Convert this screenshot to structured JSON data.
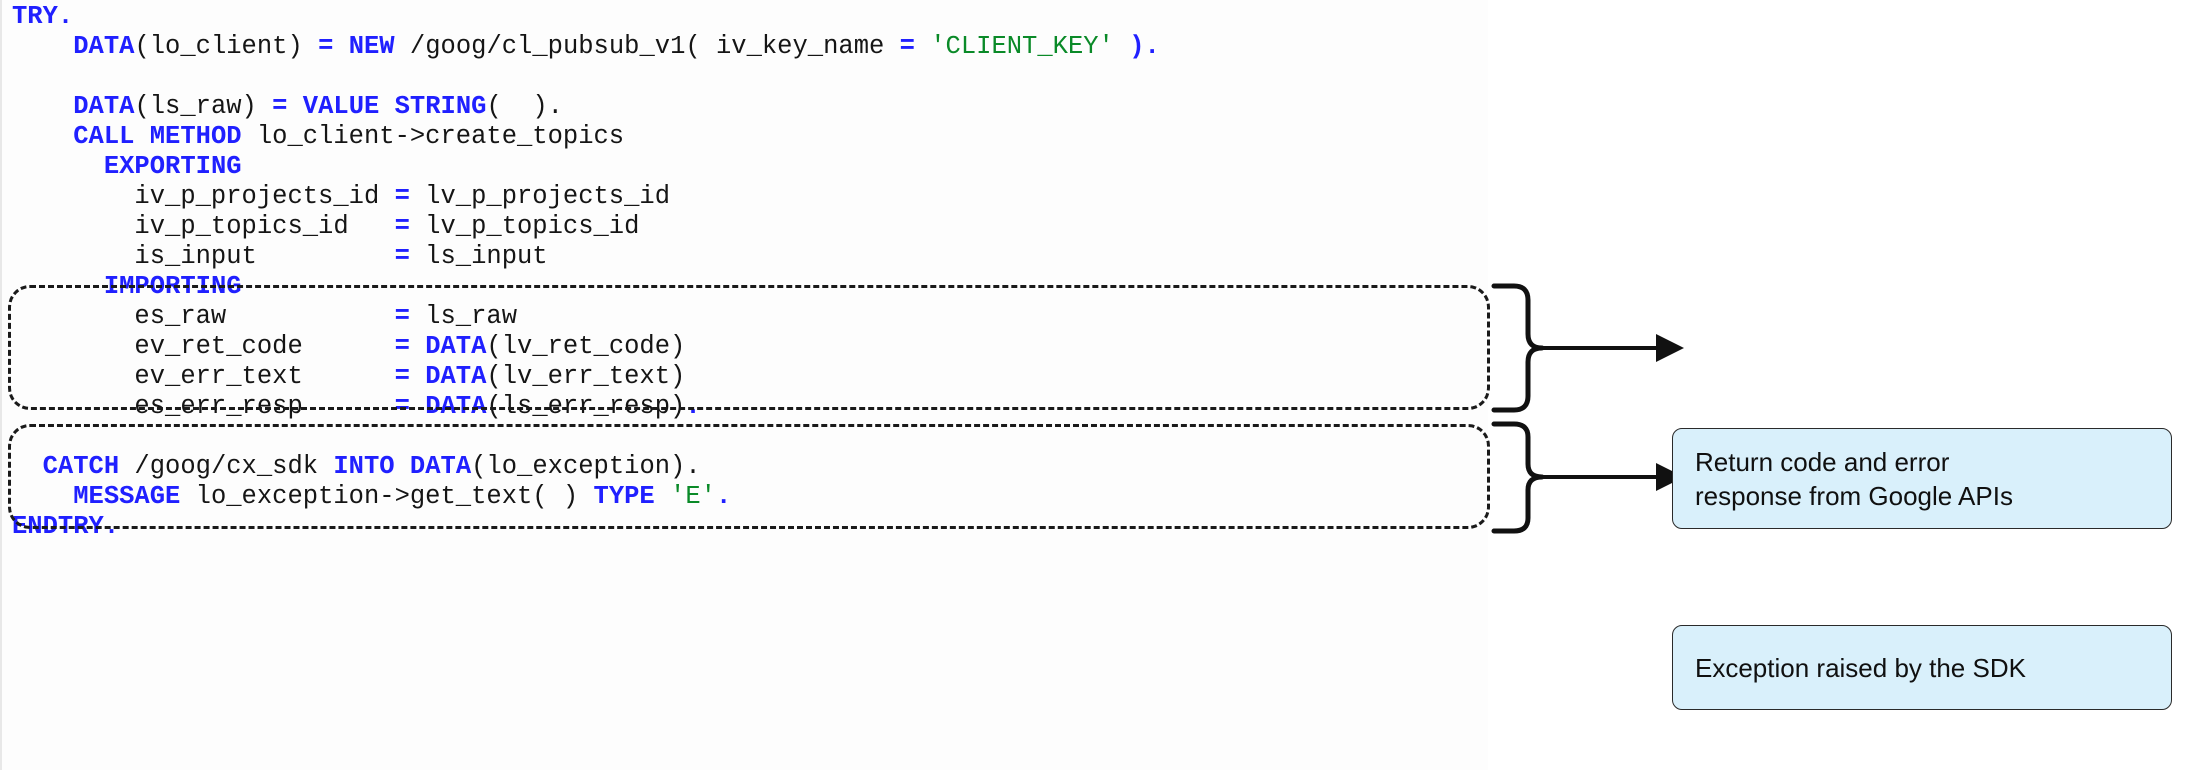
{
  "code": {
    "language": "ABAP",
    "lines": [
      [
        {
          "t": "TRY.",
          "c": "kw"
        }
      ],
      [
        {
          "t": "    ",
          "c": "pun"
        },
        {
          "t": "DATA",
          "c": "kw"
        },
        {
          "t": "(lo_client) ",
          "c": "id"
        },
        {
          "t": "=",
          "c": "op"
        },
        {
          "t": " ",
          "c": "id"
        },
        {
          "t": "NEW",
          "c": "kw"
        },
        {
          "t": " /goog/cl_pubsub_v1( iv_key_name ",
          "c": "id"
        },
        {
          "t": "=",
          "c": "op"
        },
        {
          "t": " ",
          "c": "id"
        },
        {
          "t": "'CLIENT_KEY'",
          "c": "str"
        },
        {
          "t": " ",
          "c": "id"
        },
        {
          "t": ")",
          "c": "op"
        },
        {
          "t": ".",
          "c": "op"
        }
      ],
      [
        {
          "t": "",
          "c": "pun"
        }
      ],
      [
        {
          "t": "    ",
          "c": "pun"
        },
        {
          "t": "DATA",
          "c": "kw"
        },
        {
          "t": "(ls_raw) ",
          "c": "id"
        },
        {
          "t": "=",
          "c": "op"
        },
        {
          "t": " ",
          "c": "id"
        },
        {
          "t": "VALUE",
          "c": "kw"
        },
        {
          "t": " ",
          "c": "id"
        },
        {
          "t": "STRING",
          "c": "kw"
        },
        {
          "t": "(  ).",
          "c": "id"
        }
      ],
      [
        {
          "t": "    ",
          "c": "pun"
        },
        {
          "t": "CALL METHOD",
          "c": "kw"
        },
        {
          "t": " lo_client->create_topics",
          "c": "id"
        }
      ],
      [
        {
          "t": "      ",
          "c": "pun"
        },
        {
          "t": "EXPORTING",
          "c": "kw"
        }
      ],
      [
        {
          "t": "        iv_p_projects_id ",
          "c": "id"
        },
        {
          "t": "=",
          "c": "op"
        },
        {
          "t": " lv_p_projects_id",
          "c": "id"
        }
      ],
      [
        {
          "t": "        iv_p_topics_id   ",
          "c": "id"
        },
        {
          "t": "=",
          "c": "op"
        },
        {
          "t": " lv_p_topics_id",
          "c": "id"
        }
      ],
      [
        {
          "t": "        is_input         ",
          "c": "id"
        },
        {
          "t": "=",
          "c": "op"
        },
        {
          "t": " ls_input",
          "c": "id"
        }
      ],
      [
        {
          "t": "      ",
          "c": "pun"
        },
        {
          "t": "IMPORTING",
          "c": "kw"
        }
      ],
      [
        {
          "t": "        es_raw           ",
          "c": "id"
        },
        {
          "t": "=",
          "c": "op"
        },
        {
          "t": " ls_raw",
          "c": "id"
        }
      ],
      [
        {
          "t": "        ev_ret_code      ",
          "c": "id"
        },
        {
          "t": "=",
          "c": "op"
        },
        {
          "t": " ",
          "c": "id"
        },
        {
          "t": "DATA",
          "c": "kw"
        },
        {
          "t": "(lv_ret_code)",
          "c": "id"
        }
      ],
      [
        {
          "t": "        ev_err_text      ",
          "c": "id"
        },
        {
          "t": "=",
          "c": "op"
        },
        {
          "t": " ",
          "c": "id"
        },
        {
          "t": "DATA",
          "c": "kw"
        },
        {
          "t": "(lv_err_text)",
          "c": "id"
        }
      ],
      [
        {
          "t": "        es_err_resp      ",
          "c": "id"
        },
        {
          "t": "=",
          "c": "op"
        },
        {
          "t": " ",
          "c": "id"
        },
        {
          "t": "DATA",
          "c": "kw"
        },
        {
          "t": "(ls_err_resp)",
          "c": "id"
        },
        {
          "t": ".",
          "c": "op"
        }
      ],
      [
        {
          "t": "",
          "c": "pun"
        }
      ],
      [
        {
          "t": "  ",
          "c": "pun"
        },
        {
          "t": "CATCH",
          "c": "kw"
        },
        {
          "t": " /goog/cx_sdk ",
          "c": "id"
        },
        {
          "t": "INTO",
          "c": "kw"
        },
        {
          "t": " ",
          "c": "id"
        },
        {
          "t": "DATA",
          "c": "kw"
        },
        {
          "t": "(lo_exception).",
          "c": "id"
        }
      ],
      [
        {
          "t": "    ",
          "c": "pun"
        },
        {
          "t": "MESSAGE",
          "c": "kw"
        },
        {
          "t": " lo_exception->get_text( ) ",
          "c": "id"
        },
        {
          "t": "TYPE",
          "c": "kw"
        },
        {
          "t": " ",
          "c": "id"
        },
        {
          "t": "'E'",
          "c": "str"
        },
        {
          "t": ".",
          "c": "op"
        }
      ],
      [
        {
          "t": "ENDTRY.",
          "c": "kw"
        }
      ]
    ],
    "plain_text": "TRY.\n    DATA(lo_client) = NEW /goog/cl_pubsub_v1( iv_key_name = 'CLIENT_KEY' ).\n\n    DATA(ls_raw) = VALUE STRING(  ).\n    CALL METHOD lo_client->create_topics\n      EXPORTING\n        iv_p_projects_id = lv_p_projects_id\n        iv_p_topics_id   = lv_p_topics_id\n        is_input         = ls_input\n      IMPORTING\n        es_raw           = ls_raw\n        ev_ret_code      = DATA(lv_ret_code)\n        ev_err_text      = DATA(lv_err_text)\n        es_err_resp      = DATA(ls_err_resp).\n\n  CATCH /goog/cx_sdk INTO DATA(lo_exception).\n    MESSAGE lo_exception->get_text( ) TYPE 'E'.\nENDTRY."
  },
  "annotations": [
    {
      "id": "return-code",
      "text_lines": [
        "Return code and error",
        "response from Google APIs"
      ]
    },
    {
      "id": "exception",
      "text_lines": [
        "Exception raised by the SDK"
      ]
    }
  ],
  "colors": {
    "keyword": "#2020ff",
    "identifier": "#151515",
    "string": "#0a8a28",
    "callout_fill": "#d9f0fb",
    "callout_border": "#2a2a2a",
    "annotation_dash": "#1a1a1a",
    "code_background": "#fdfdfd"
  }
}
